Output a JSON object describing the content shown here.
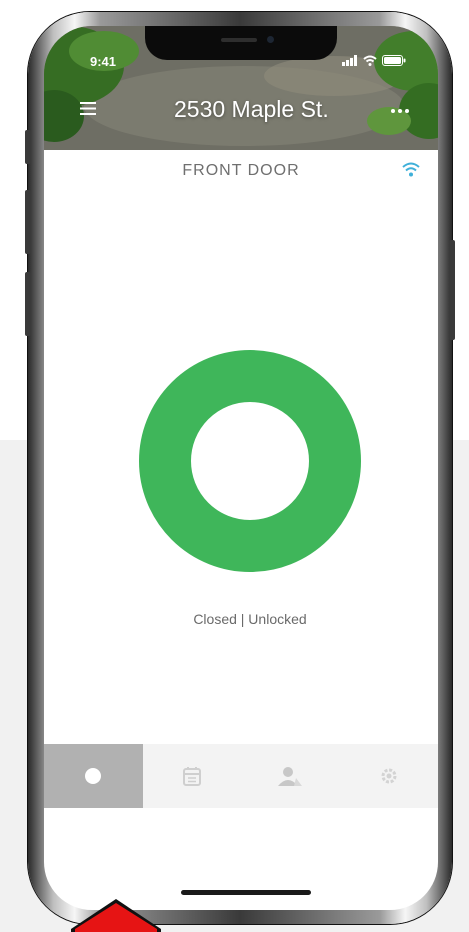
{
  "status_bar": {
    "time": "9:41",
    "icons": [
      "signal-icon",
      "wifi-icon",
      "battery-icon"
    ]
  },
  "header": {
    "address": "2530 Maple St.",
    "menu_icon": "hamburger-menu-icon",
    "more_icon": "more-dots-icon"
  },
  "door": {
    "name": "FRONT DOOR",
    "connection_icon": "wifi-icon",
    "status": "Closed | Unlocked",
    "status_color": "#3fb65a"
  },
  "tabs": [
    {
      "name": "home",
      "icon": "circle-icon",
      "active": true
    },
    {
      "name": "history",
      "icon": "calendar-icon",
      "active": false
    },
    {
      "name": "users",
      "icon": "person-icon",
      "active": false
    },
    {
      "name": "settings",
      "icon": "gear-icon",
      "active": false
    }
  ],
  "highlight_arrow_color": "#e61414"
}
